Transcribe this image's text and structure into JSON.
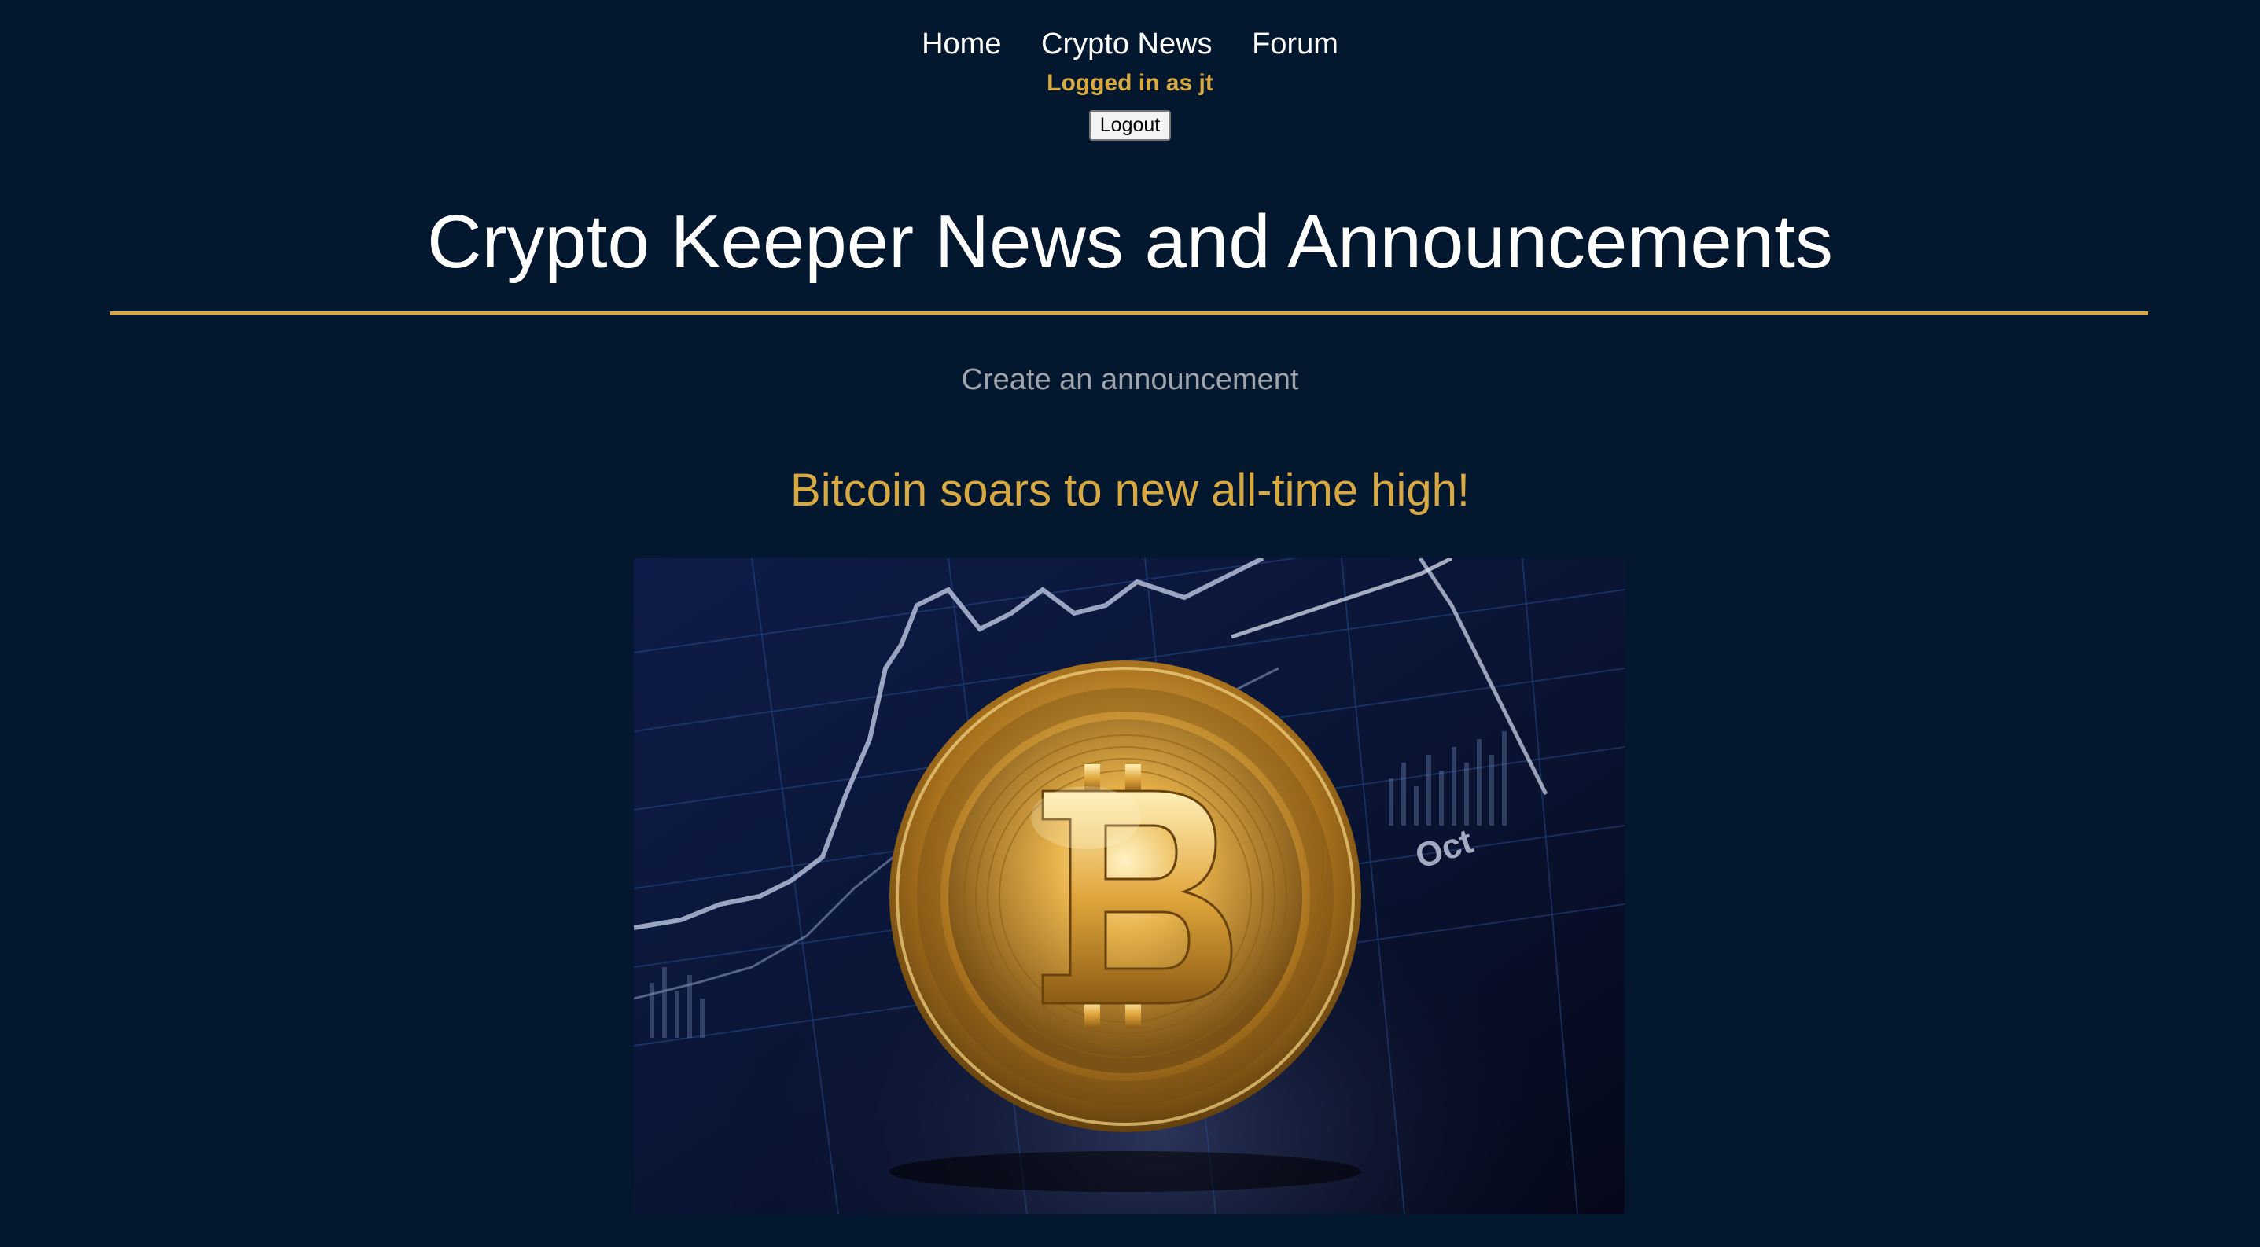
{
  "nav": {
    "items": [
      {
        "label": "Home"
      },
      {
        "label": "Crypto News"
      },
      {
        "label": "Forum"
      }
    ],
    "login_status": "Logged in as jt",
    "logout_label": "Logout"
  },
  "header": {
    "title": "Crypto Keeper News and Announcements"
  },
  "main": {
    "create_link": "Create an announcement",
    "posts": [
      {
        "title": "Bitcoin soars to new all-time high!",
        "image_label": "Oct",
        "image_icon": "bitcoin-coin-icon"
      }
    ]
  },
  "colors": {
    "background": "#03172f",
    "accent": "#d9a941",
    "muted": "#a0a4ab"
  }
}
